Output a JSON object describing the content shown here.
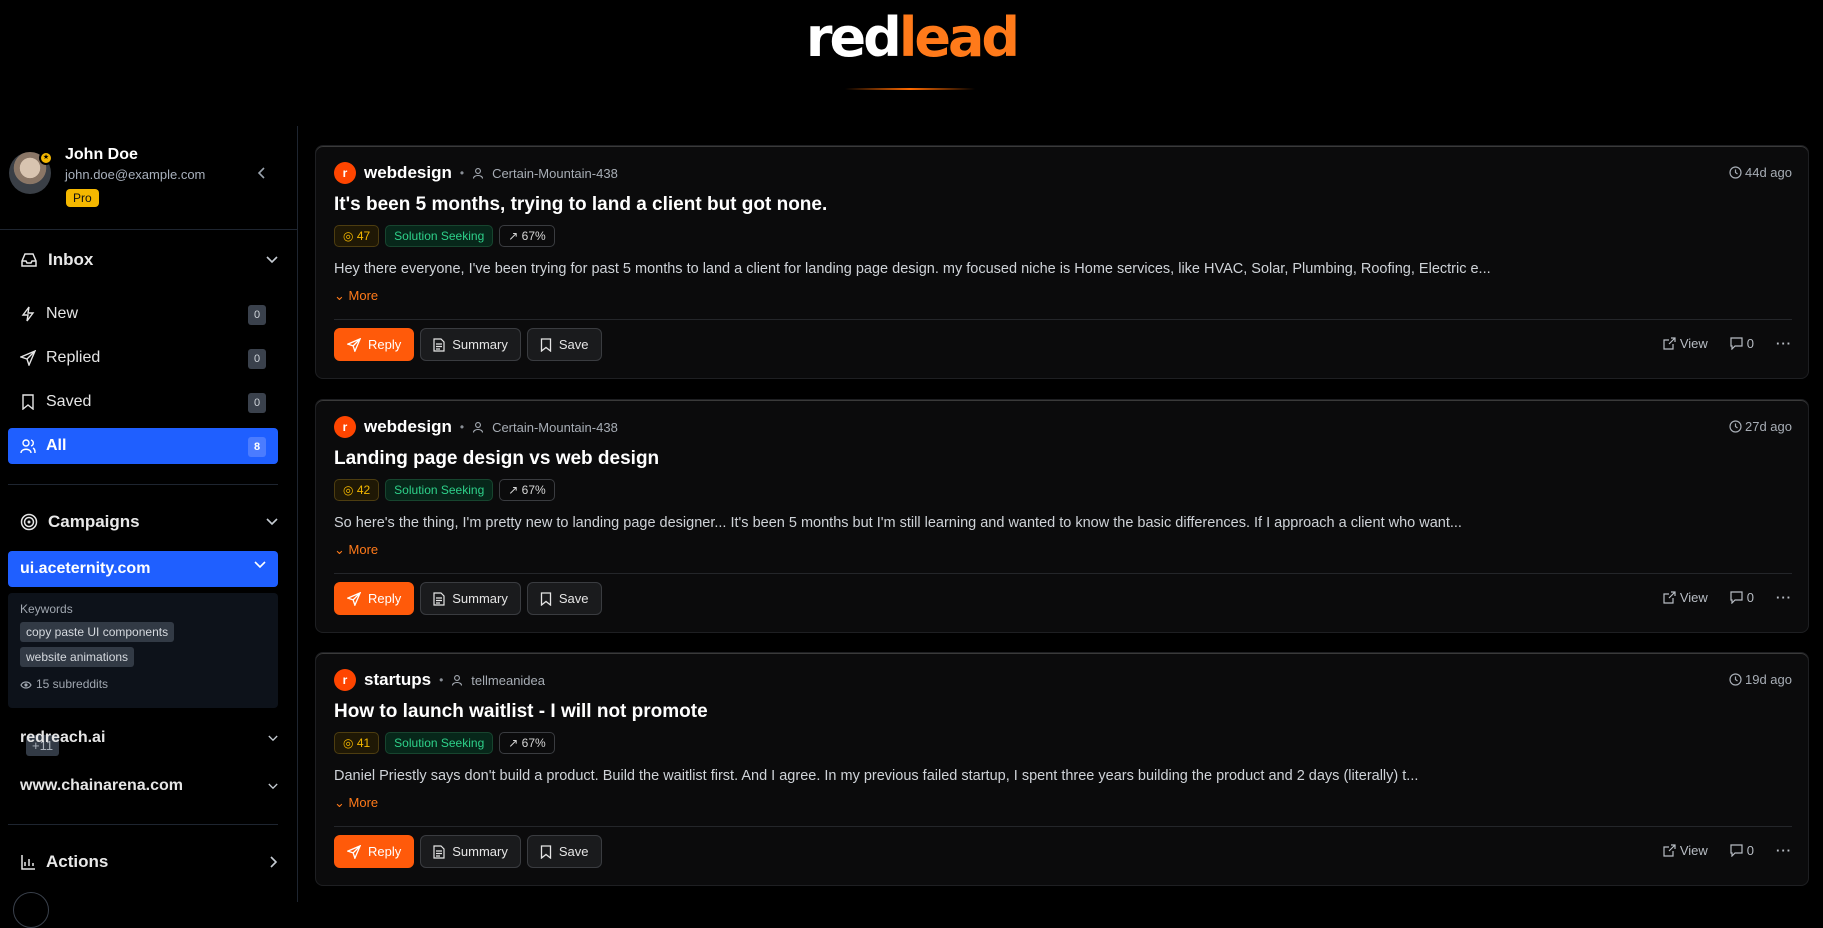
{
  "logo": {
    "part1": "red",
    "part2": "lead"
  },
  "profile": {
    "name": "John Doe",
    "email": "john.doe@example.com",
    "plan": "Pro"
  },
  "inbox": {
    "title": "Inbox",
    "items": [
      {
        "label": "New",
        "count": "0",
        "icon": "lightning-icon"
      },
      {
        "label": "Replied",
        "count": "0",
        "icon": "send-icon"
      },
      {
        "label": "Saved",
        "count": "0",
        "icon": "bookmark-icon"
      },
      {
        "label": "All",
        "count": "8",
        "icon": "users-icon",
        "active": true
      }
    ]
  },
  "campaigns": {
    "title": "Campaigns",
    "active": "ui.aceternity.com",
    "keywords_label": "Keywords",
    "keywords": [
      "copy paste UI components",
      "website animations"
    ],
    "more_keywords": "+11",
    "subreddits": "15 subreddits",
    "others": [
      "redreach.ai",
      "www.chainarena.com"
    ]
  },
  "actions_label": "Actions",
  "posts": [
    {
      "subreddit": "webdesign",
      "author": "Certain-Mountain-438",
      "time": "44d ago",
      "title": "It's been 5 months, trying to land a client but got none.",
      "score": "47",
      "intent": "Solution Seeking",
      "trend": "67%",
      "excerpt": "Hey there everyone, I've been trying for past 5 months to land a client for landing page design. my focused niche is Home services, like HVAC, Solar, Plumbing, Roofing, Electric e...",
      "comments": "0"
    },
    {
      "subreddit": "webdesign",
      "author": "Certain-Mountain-438",
      "time": "27d ago",
      "title": "Landing page design vs web design",
      "score": "42",
      "intent": "Solution Seeking",
      "trend": "67%",
      "excerpt": "So here's the thing, I'm pretty new to landing page designer... It's been 5 months but I'm still learning and wanted to know the basic differences. If I approach a client who want...",
      "comments": "0"
    },
    {
      "subreddit": "startups",
      "author": "tellmeanidea",
      "time": "19d ago",
      "title": "How to launch waitlist - I will not promote",
      "score": "41",
      "intent": "Solution Seeking",
      "trend": "67%",
      "excerpt": "Daniel Priestly says don't build a product. Build the waitlist first. And I agree. In my previous failed startup, I spent three years building the product and 2 days (literally) t...",
      "comments": "0"
    }
  ],
  "labels": {
    "more": "More",
    "reply": "Reply",
    "summary": "Summary",
    "save": "Save",
    "view": "View",
    "subreddit_icon": "r"
  },
  "colors": {
    "accent": "#ff5a0a",
    "active_nav": "#1f5fff",
    "intent": "#2ed18a",
    "score": "#f5b800"
  }
}
